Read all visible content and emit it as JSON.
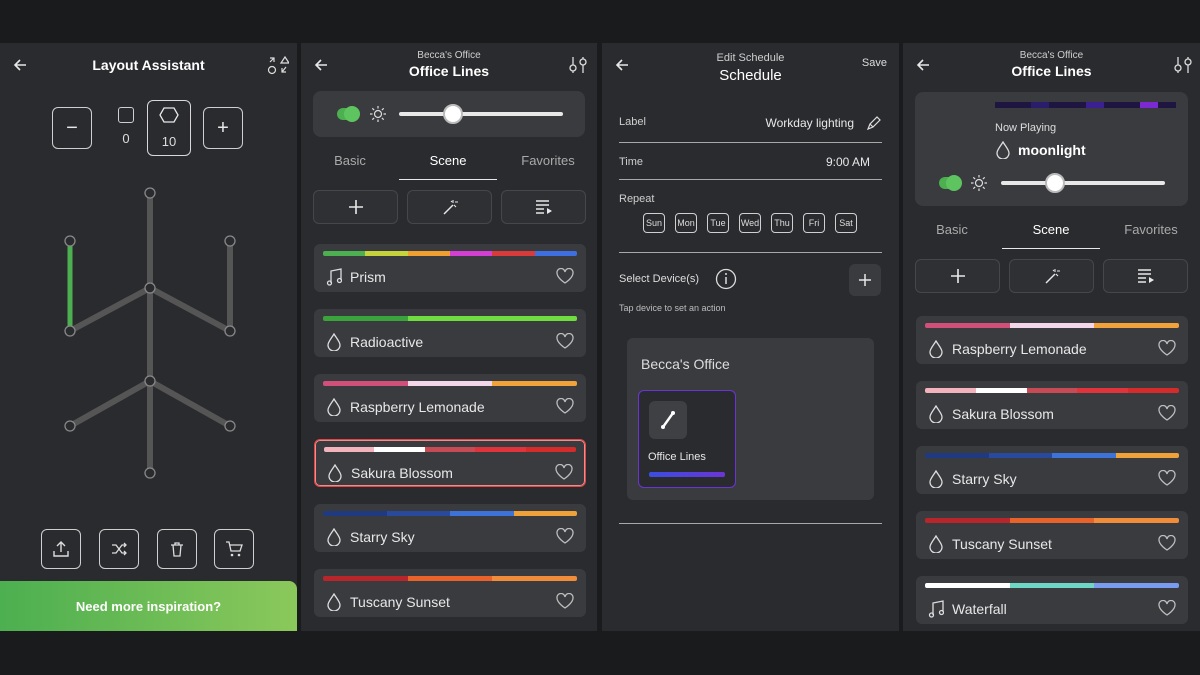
{
  "layout_assistant": {
    "title": "Layout Assistant",
    "minus_label": "−",
    "plus_label": "+",
    "count_square": "0",
    "count_hex": "10",
    "inspire_label": "Need more inspiration?"
  },
  "office_lines_a": {
    "subtitle": "Becca's Office",
    "title": "Office Lines",
    "brightness": 0.33,
    "tabs": [
      "Basic",
      "Scene",
      "Favorites"
    ],
    "active_tab": "Scene",
    "scenes": [
      {
        "name": "Prism",
        "icon": "music-note-icon",
        "colors": [
          "#4caf50",
          "#c6d33b",
          "#f0a030",
          "#d23fd2",
          "#d93a3a",
          "#3d6fe0"
        ]
      },
      {
        "name": "Radioactive",
        "icon": "droplet-icon",
        "colors": [
          "#3ba33b",
          "#6fdc3f",
          "#6fdc3f"
        ]
      },
      {
        "name": "Raspberry Lemonade",
        "icon": "droplet-icon",
        "colors": [
          "#d0507a",
          "#f4d6ea",
          "#f2a23a"
        ]
      },
      {
        "name": "Sakura Blossom",
        "icon": "droplet-icon",
        "colors": [
          "#f2b3bd",
          "#ffffff",
          "#c64b55",
          "#e0333c",
          "#d62b2b"
        ],
        "selected": true
      },
      {
        "name": "Starry Sky",
        "icon": "droplet-icon",
        "colors": [
          "#1f3a80",
          "#294a9c",
          "#3d72d8",
          "#f0a23a"
        ]
      },
      {
        "name": "Tuscany Sunset",
        "icon": "droplet-icon",
        "colors": [
          "#b8262c",
          "#e8622a",
          "#f08c3a"
        ]
      }
    ]
  },
  "schedule": {
    "subtitle": "Edit Schedule",
    "title": "Schedule",
    "save_label": "Save",
    "label_label": "Label",
    "label_value": "Workday lighting",
    "time_label": "Time",
    "time_value": "9:00 AM",
    "repeat_label": "Repeat",
    "days": [
      "Sun",
      "Mon",
      "Tue",
      "Wed",
      "Thu",
      "Fri",
      "Sat"
    ],
    "select_devices_label": "Select Device(s)",
    "tap_hint": "Tap device to set an action",
    "room_name": "Becca's Office",
    "device_name": "Office Lines"
  },
  "office_lines_b": {
    "subtitle": "Becca's Office",
    "title": "Office Lines",
    "now_playing_label": "Now Playing",
    "now_playing_name": "moonlight",
    "brightness": 0.33,
    "tabs": [
      "Basic",
      "Scene",
      "Favorites"
    ],
    "active_tab": "Scene",
    "scenes": [
      {
        "name": "Raspberry Lemonade",
        "icon": "droplet-icon",
        "colors": [
          "#d0507a",
          "#f4d6ea",
          "#f2a23a"
        ]
      },
      {
        "name": "Sakura Blossom",
        "icon": "droplet-icon",
        "colors": [
          "#f2b3bd",
          "#ffffff",
          "#c64b55",
          "#e0333c",
          "#d62b2b"
        ]
      },
      {
        "name": "Starry Sky",
        "icon": "droplet-icon",
        "colors": [
          "#1f3a80",
          "#294a9c",
          "#3d72d8",
          "#f0a23a"
        ]
      },
      {
        "name": "Tuscany Sunset",
        "icon": "droplet-icon",
        "colors": [
          "#b8262c",
          "#e8622a",
          "#f08c3a"
        ]
      },
      {
        "name": "Waterfall",
        "icon": "music-note-icon",
        "colors": [
          "#ffffff",
          "#6fd6c6",
          "#7a9cf0"
        ]
      }
    ]
  },
  "colors": {
    "accent_green": "#4caf50",
    "selection_red": "#e24646",
    "device_purple": "#6b35d6"
  }
}
